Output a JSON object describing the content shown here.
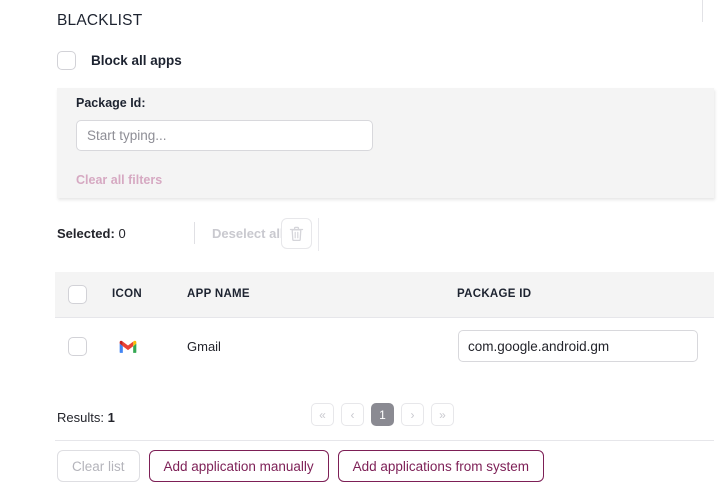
{
  "section": {
    "title": "BLACKLIST"
  },
  "block_all": {
    "label": "Block all apps",
    "checked": false,
    "checkbox_name": "block-all-apps-checkbox"
  },
  "filters": {
    "package_id_label": "Package Id:",
    "package_id_value": "",
    "package_id_placeholder": "Start typing...",
    "clear_all_label": "Clear all filters",
    "clear_all_color": "#d6a9c2"
  },
  "selection": {
    "selected_label": "Selected:",
    "selected_count": "0",
    "deselect_all_label": "Deselect all",
    "deselect_all_enabled": false,
    "delete_icon": "trash-icon"
  },
  "table": {
    "columns": [
      "ICON",
      "APP NAME",
      "PACKAGE ID"
    ],
    "select_all_checked": false,
    "rows": [
      {
        "checked": false,
        "icon": "gmail-icon",
        "app_name": "Gmail",
        "package_id": "com.google.android.gm"
      }
    ]
  },
  "footer": {
    "results_label": "Results:",
    "results_count": "1",
    "pagination": {
      "first_label": "«",
      "prev_label": "‹",
      "pages": [
        "1"
      ],
      "current_page": "1",
      "next_label": "›",
      "last_label": "»",
      "active_bg": "#8a8a92"
    }
  },
  "actions": {
    "clear_list_label": "Clear list",
    "clear_list_enabled": false,
    "add_manual_label": "Add application manually",
    "add_system_label": "Add applications from system",
    "outline_color": "#7d1f56"
  }
}
